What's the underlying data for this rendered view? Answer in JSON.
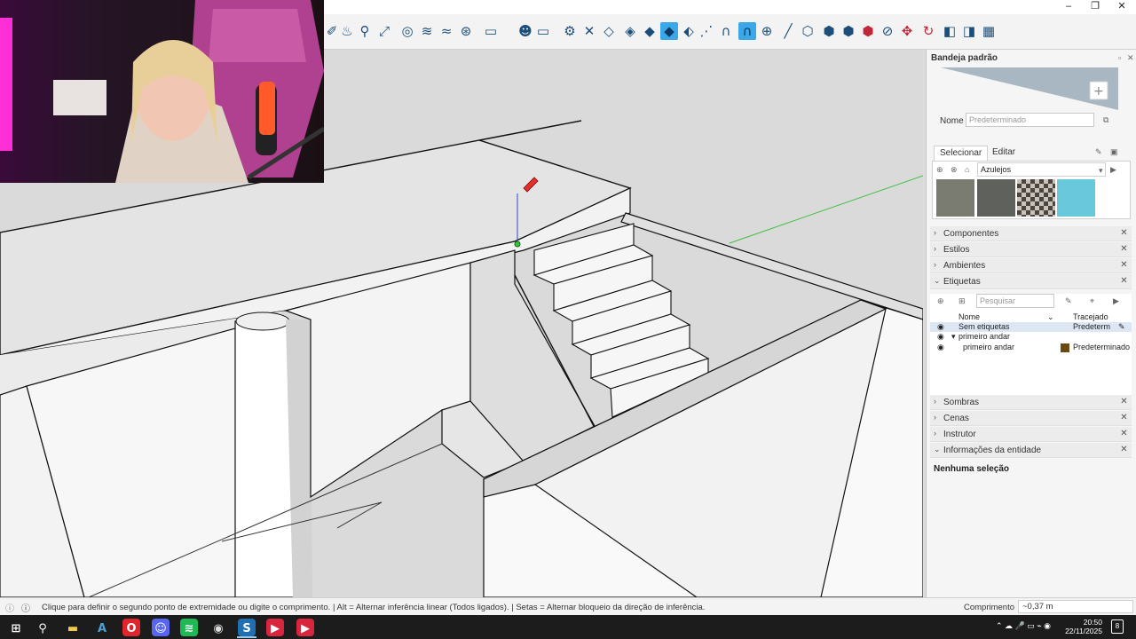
{
  "window": {
    "minimize": "–",
    "maximize": "❐",
    "close": "✕"
  },
  "toolbar": {
    "tools": [
      {
        "icon": "eraser-icon"
      },
      {
        "icon": "paint-icon"
      },
      {
        "icon": "zoom-icon"
      },
      {
        "icon": "zoom-extents-icon"
      },
      {
        "icon": "section-plane-icon"
      },
      {
        "icon": "section-fill-icon"
      },
      {
        "icon": "section-cut-icon"
      },
      {
        "icon": "warehouse-icon"
      },
      {
        "icon": "new-page-icon"
      },
      {
        "icon": "account-icon"
      },
      {
        "icon": "rectangle-icon"
      },
      {
        "icon": "settings-icon"
      },
      {
        "icon": "close-icon"
      },
      {
        "icon": "drop-outline-icon"
      },
      {
        "icon": "drop-half-icon"
      },
      {
        "icon": "drop-solid-icon"
      },
      {
        "icon": "drop-active-icon"
      },
      {
        "icon": "drop-split-icon"
      },
      {
        "icon": "magnet-dotted-icon"
      },
      {
        "icon": "magnet-icon"
      },
      {
        "icon": "magnet-active-icon"
      },
      {
        "icon": "add-circle-icon"
      },
      {
        "icon": "line-tool-icon"
      },
      {
        "icon": "cube-outline-icon"
      },
      {
        "icon": "cube-front-icon"
      },
      {
        "icon": "cube-blue-icon"
      },
      {
        "icon": "cube-red-icon"
      },
      {
        "icon": "cube-strike-icon"
      },
      {
        "icon": "move-icon"
      },
      {
        "icon": "rotate-icon"
      },
      {
        "icon": "layers-icon"
      },
      {
        "icon": "layers-blue-icon"
      },
      {
        "icon": "layers-grid-icon"
      }
    ]
  },
  "tray": {
    "title": "Bandeja padrão",
    "name_label": "Nome",
    "name_placeholder": "Predeterminado",
    "tabs": [
      {
        "label": "Selecionar"
      },
      {
        "label": "Editar"
      }
    ],
    "library": "Azulejos",
    "swatches": [
      "#7a7c72",
      "#5f615c",
      "#8a847a",
      "#69c8db"
    ],
    "sections": [
      {
        "label": "Componentes"
      },
      {
        "label": "Estilos"
      },
      {
        "label": "Ambientes"
      }
    ],
    "tags": {
      "label": "Etiquetas",
      "search_placeholder": "Pesquisar",
      "col_name": "Nome",
      "col_dash": "Tracejado",
      "rows": [
        {
          "name": "Sem etiquetas",
          "dash": "Predeterm",
          "selected": true
        },
        {
          "name": "primeiro andar",
          "dash": ""
        },
        {
          "name": "primeiro andar",
          "dash": "Predeterminado",
          "color": "#6a4a12"
        }
      ]
    },
    "more_sections": [
      {
        "label": "Sombras"
      },
      {
        "label": "Cenas"
      },
      {
        "label": "Instrutor"
      }
    ],
    "entity_info": {
      "label": "Informações da entidade",
      "message": "Nenhuma seleção"
    }
  },
  "status": {
    "message": "Clique para definir o segundo ponto de extremidade ou digite o comprimento. | Alt = Alternar inferência linear (Todos ligados). | Setas = Alternar bloqueio da direção de inferência.",
    "length_label": "Comprimento",
    "length_value": "~0,37 m"
  },
  "taskbar": {
    "time": "20:50",
    "date": "22/11/2025",
    "notifications": "8",
    "apps": [
      {
        "icon": "windows-start-icon",
        "color": "#ffffff"
      },
      {
        "icon": "search-icon",
        "color": "#ffffff"
      },
      {
        "icon": "file-explorer-icon",
        "color": "#f2c94c"
      },
      {
        "icon": "autocad-icon",
        "color": "#4ea1d3"
      },
      {
        "icon": "opera-icon",
        "color": "#e0262d"
      },
      {
        "icon": "discord-icon",
        "color": "#5865f2"
      },
      {
        "icon": "spotify-icon",
        "color": "#1db954"
      },
      {
        "icon": "obs-icon",
        "color": "#dddddd"
      },
      {
        "icon": "sketchup-icon",
        "color": "#1f6fb2"
      },
      {
        "icon": "red-app-icon",
        "color": "#d7263d"
      },
      {
        "icon": "red-app-2-icon",
        "color": "#d7263d"
      }
    ]
  }
}
